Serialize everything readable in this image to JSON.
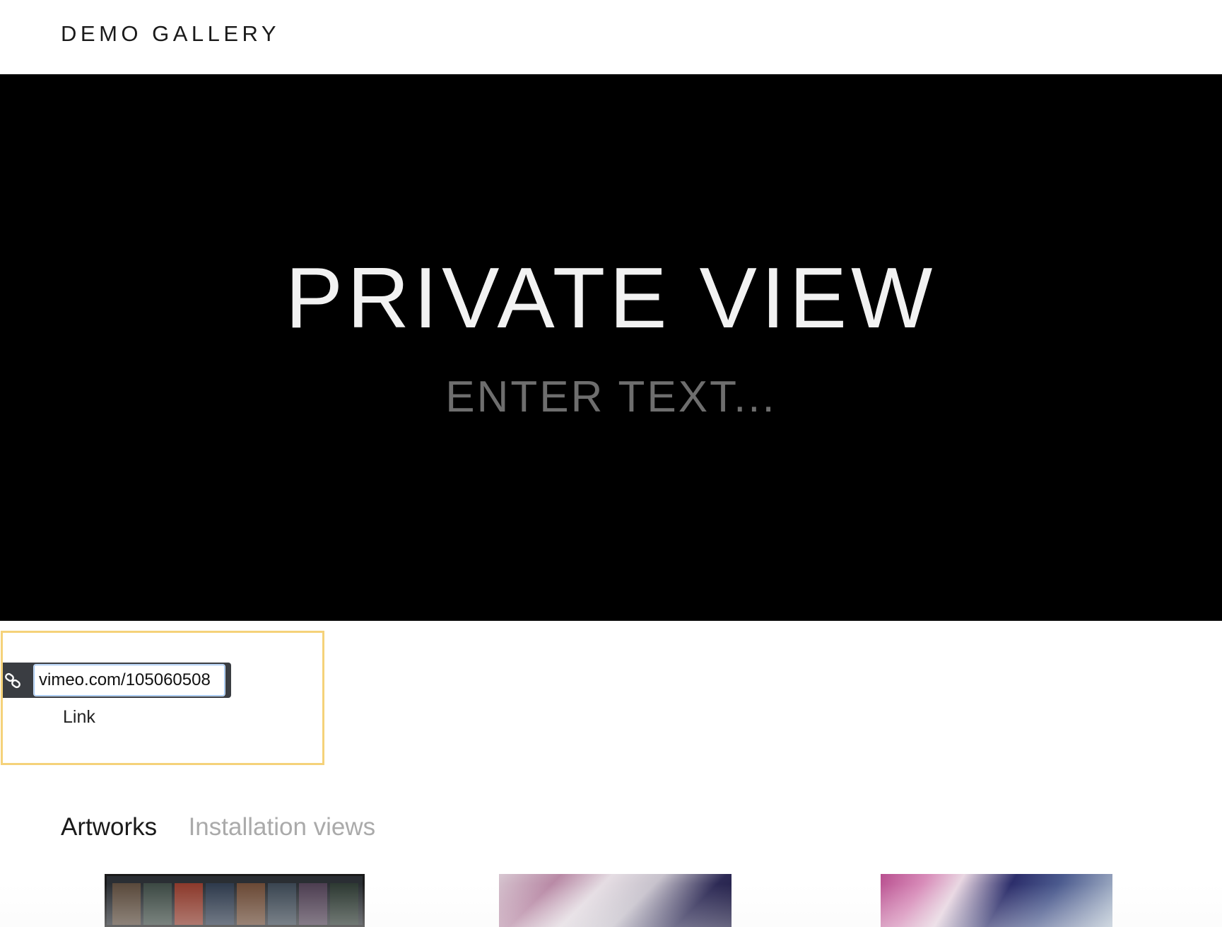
{
  "header": {
    "site_title": "DEMO GALLERY"
  },
  "hero": {
    "title": "PRIVATE VIEW",
    "subtitle": "ENTER TEXT..."
  },
  "link_editor": {
    "url_value": "vimeo.com/105060508",
    "label": "Link",
    "icon": "link-icon"
  },
  "tabs": [
    {
      "label": "Artworks",
      "active": true
    },
    {
      "label": "Installation views",
      "active": false
    }
  ],
  "colors": {
    "hero_background": "#000000",
    "selection_border": "#f5d27a",
    "toolbar_background": "#3a3d42",
    "inactive_tab": "#aaaaaa"
  }
}
